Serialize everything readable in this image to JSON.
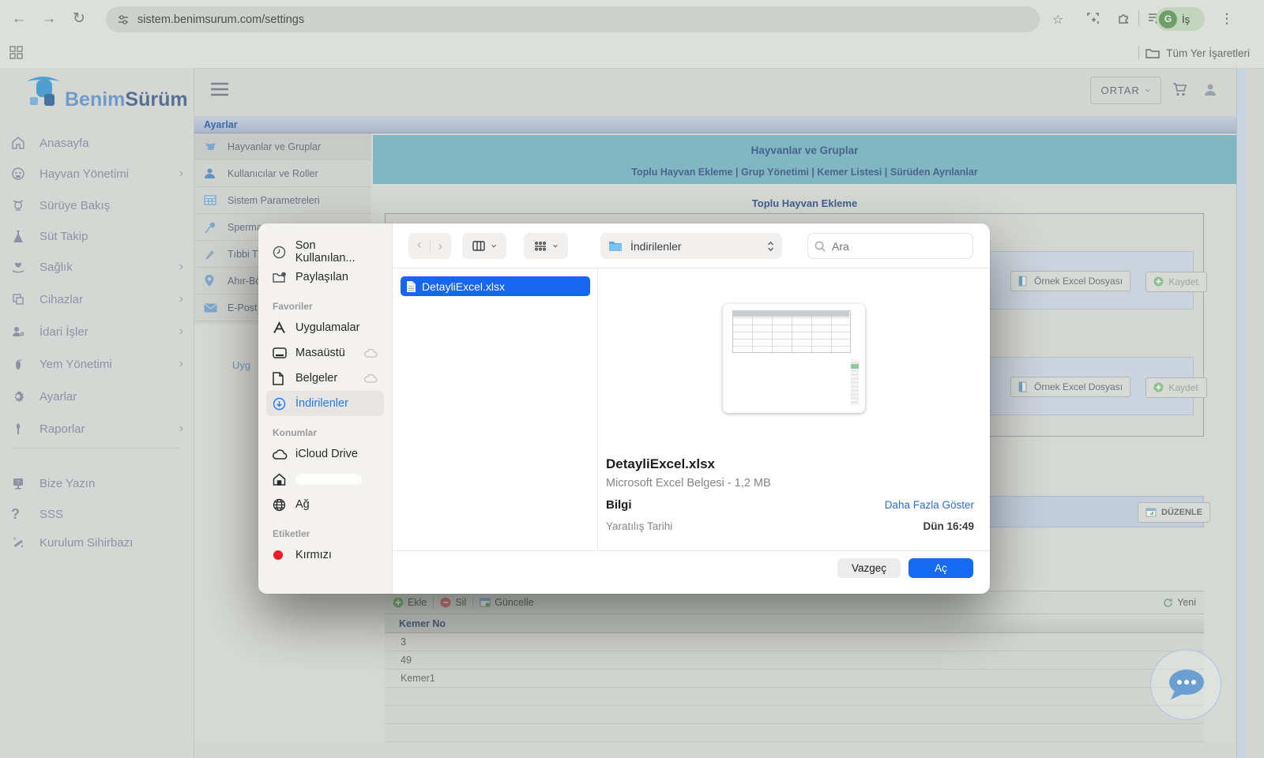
{
  "browser": {
    "url": "sistem.benimsurum.com/settings",
    "profile": {
      "initial": "G",
      "label": "İş"
    },
    "bookmarks_label": "Tüm Yer İşaretleri"
  },
  "app": {
    "logo": {
      "part1": "Benim",
      "part2": "Sürüm"
    },
    "header": {
      "herd_selector": "ORTAR"
    },
    "sidebar": {
      "items": [
        {
          "label": "Anasayfa"
        },
        {
          "label": "Hayvan Yönetimi"
        },
        {
          "label": "Sürüye Bakış"
        },
        {
          "label": "Süt Takip"
        },
        {
          "label": "Sağlık"
        },
        {
          "label": "Cihazlar"
        },
        {
          "label": "İdari İşler"
        },
        {
          "label": "Yem Yönetimi"
        },
        {
          "label": "Ayarlar"
        },
        {
          "label": "Raporlar"
        },
        {
          "label": "Bize Yazın"
        },
        {
          "label": "SSS"
        },
        {
          "label": "Kurulum Sihirbazı"
        }
      ]
    },
    "settings_menu": {
      "title": "Ayarlar",
      "items": [
        {
          "label": "Hayvanlar ve Gruplar"
        },
        {
          "label": "Kullanıcılar ve Roller"
        },
        {
          "label": "Sistem Parametreleri"
        },
        {
          "label": "Sperma"
        },
        {
          "label": "Tıbbi T"
        },
        {
          "label": "Ahır-Bö"
        },
        {
          "label": "E-Post"
        }
      ],
      "partial_text": "Uyg"
    },
    "content": {
      "panel_title": "Hayvanlar ve Gruplar",
      "tabs_line": "Toplu Hayvan Ekleme  |  Grup Yönetimi  |  Kemer Listesi  |  Sürüden Ayrılanlar",
      "section_title": "Toplu Hayvan Ekleme",
      "sample_excel_button": "Örnek Excel Dosyası",
      "save_button": "Kaydet",
      "edit_button": "DÜZENLE",
      "grid_toolbar": {
        "add": "Ekle",
        "delete": "Sil",
        "update": "Güncelle",
        "refresh": "Yeni"
      },
      "belt_table": {
        "header": "Kemer No",
        "rows": [
          "3",
          "49",
          "Kemer1"
        ]
      }
    }
  },
  "dialog": {
    "sidebar": {
      "recents": "Son Kullanılan...",
      "shared": "Paylaşılan",
      "favorites_header": "Favoriler",
      "applications": "Uygulamalar",
      "desktop": "Masaüstü",
      "documents": "Belgeler",
      "downloads": "İndirilenler",
      "locations_header": "Konumlar",
      "icloud": "iCloud Drive",
      "network": "Ağ",
      "tags_header": "Etiketler",
      "tag_red": "Kırmızı"
    },
    "toolbar": {
      "location": "İndirilenler",
      "search_placeholder": "Ara"
    },
    "file_list": {
      "selected_file": "DetayliExcel.xlsx"
    },
    "preview": {
      "file_name": "DetayliExcel.xlsx",
      "file_meta": "Microsoft Excel Belgesi - 1,2 MB",
      "info_label": "Bilgi",
      "show_more": "Daha Fazla Göster",
      "created_label": "Yaratılış Tarihi",
      "created_value": "Dün 16:49"
    },
    "buttons": {
      "cancel": "Vazgeç",
      "open": "Aç"
    }
  }
}
